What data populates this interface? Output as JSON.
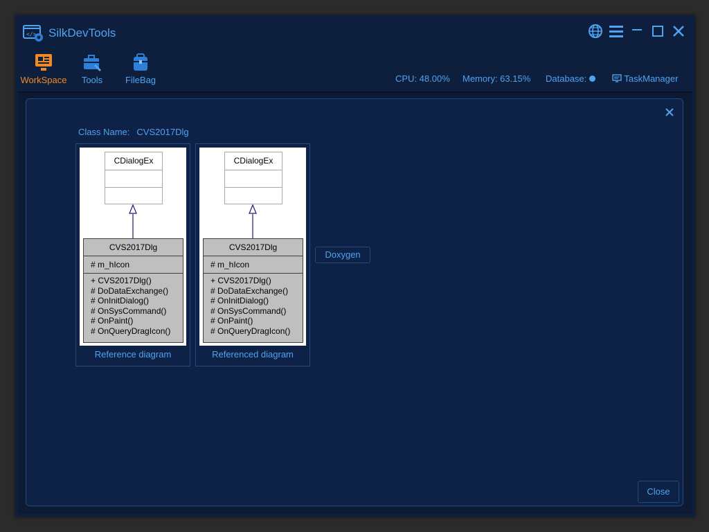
{
  "app": {
    "title": "SilkDevTools"
  },
  "window_controls": {
    "icons": [
      "globe-icon",
      "menu-icon",
      "minimize-icon",
      "maximize-icon",
      "close-icon"
    ]
  },
  "toolbar": {
    "items": [
      {
        "label": "WorkSpace",
        "icon": "monitor-icon",
        "active": true
      },
      {
        "label": "Tools",
        "icon": "toolbox-icon",
        "active": false
      },
      {
        "label": "FileBag",
        "icon": "bag-icon",
        "active": false
      }
    ]
  },
  "status": {
    "cpu": "CPU: 48.00%",
    "memory": "Memory: 63.15%",
    "database": "Database:",
    "task_manager": "TaskManager"
  },
  "dialog": {
    "class_name_label": "Class Name:",
    "class_name_value": "CVS2017Dlg",
    "diagrams": [
      {
        "caption": "Reference diagram",
        "base_class": "CDialogEx",
        "class_name": "CVS2017Dlg",
        "attribute": "# m_hIcon",
        "operations": [
          "+ CVS2017Dlg()",
          "# DoDataExchange()",
          "# OnInitDialog()",
          "# OnSysCommand()",
          "# OnPaint()",
          "# OnQueryDragIcon()"
        ]
      },
      {
        "caption": "Referenced diagram",
        "base_class": "CDialogEx",
        "class_name": "CVS2017Dlg",
        "attribute": "# m_hIcon",
        "operations": [
          "+ CVS2017Dlg()",
          "# DoDataExchange()",
          "# OnInitDialog()",
          "# OnSysCommand()",
          "# OnPaint()",
          "# OnQueryDragIcon()"
        ]
      }
    ],
    "doxygen_button": "Doxygen",
    "close_button": "Close"
  },
  "colors": {
    "accent": "#4fa3f0",
    "active": "#f08a24",
    "window_bg": "#0e1f3d",
    "dialog_bg": "#0e2146"
  }
}
